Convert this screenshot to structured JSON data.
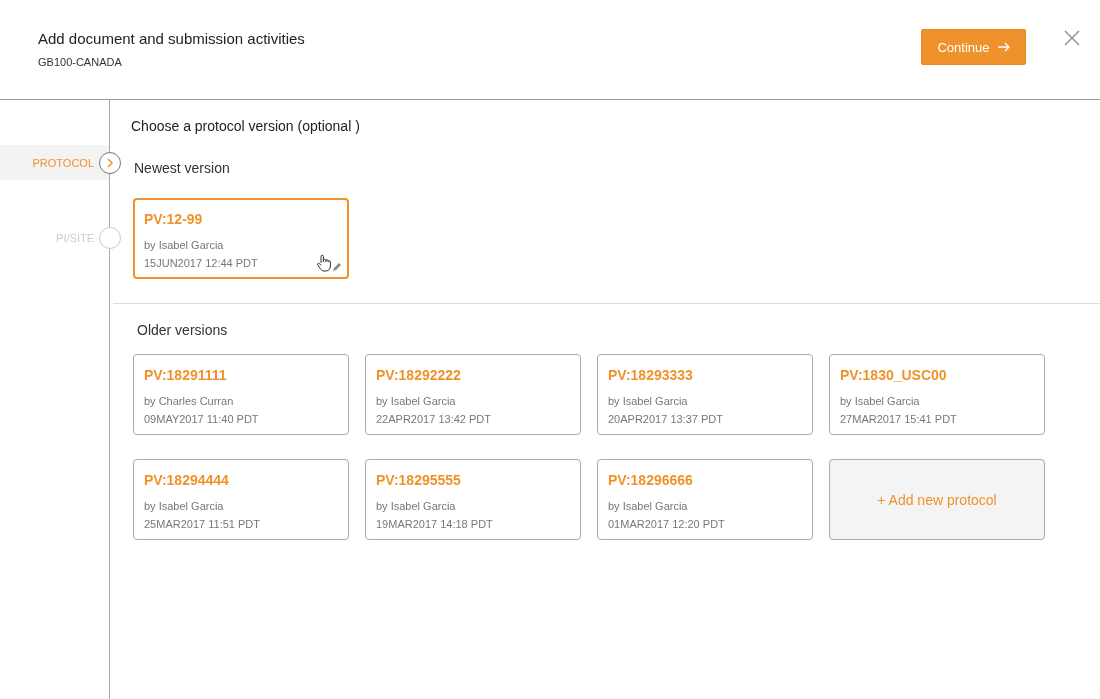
{
  "header": {
    "title": "Add document and submission activities",
    "subtitle": "GB100-CANADA",
    "continue_button": "Continue"
  },
  "steps": [
    {
      "label": "PROTOCOL",
      "selected": true
    },
    {
      "label": "PI/SITE",
      "selected": false
    }
  ],
  "heading": "Choose a protocol version (optional )",
  "newest": {
    "title": "Newest version",
    "versions": [
      {
        "name": "PV:12-99",
        "author": "by Isabel Garcia",
        "date": "15JUN2017 12:44 PDT",
        "selected": true
      }
    ]
  },
  "older": {
    "title": "Older versions",
    "versions": [
      {
        "name": "PV:18291111",
        "author": "by Charles Curran",
        "date": "09MAY2017 11:40 PDT",
        "selected": false
      },
      {
        "name": "PV:18292222",
        "author": "by Isabel Garcia",
        "date": "22APR2017 13:42 PDT",
        "selected": false
      },
      {
        "name": "PV:18293333",
        "author": "by Isabel Garcia",
        "date": "20APR2017 13:37 PDT",
        "selected": false
      },
      {
        "name": "PV:1830_USC00",
        "author": "by Isabel Garcia",
        "date": "27MAR2017 15:41 PDT",
        "selected": false
      },
      {
        "name": "PV:18294444",
        "author": "by Isabel Garcia",
        "date": "25MAR2017 11:51 PDT",
        "selected": false
      },
      {
        "name": "PV:18295555",
        "author": "by Isabel Garcia",
        "date": "19MAR2017 14:18 PDT",
        "selected": false
      },
      {
        "name": "PV:18296666",
        "author": "by Isabel Garcia",
        "date": "01MAR2017 12:20 PDT",
        "selected": false
      }
    ],
    "add_button": "+ Add new protocol"
  }
}
